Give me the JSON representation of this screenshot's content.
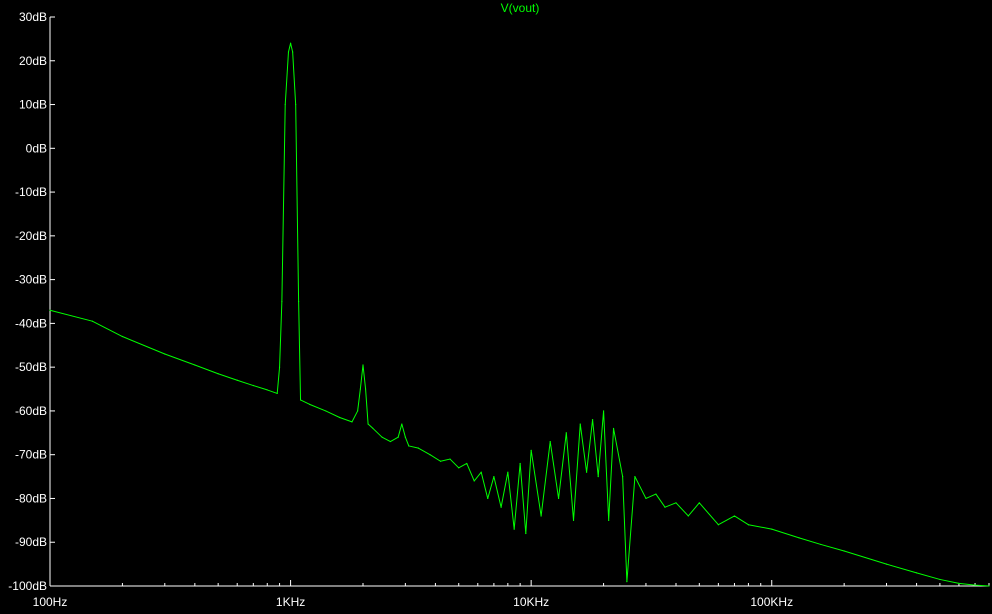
{
  "colors": {
    "background": "#000000",
    "axis": "#ffffff",
    "trace": "#00ff00",
    "title": "#00ff00",
    "tick_text": "#ffffff"
  },
  "chart_data": {
    "type": "line",
    "title": "V(vout)",
    "xlabel": "",
    "ylabel": "",
    "x_scale": "log",
    "xlim": [
      100,
      800000
    ],
    "ylim": [
      -100,
      30
    ],
    "y_ticks": [
      30,
      20,
      10,
      0,
      -10,
      -20,
      -30,
      -40,
      -50,
      -60,
      -70,
      -80,
      -90,
      -100
    ],
    "y_tick_labels": [
      "30dB",
      "20dB",
      "10dB",
      "0dB",
      "-10dB",
      "-20dB",
      "-30dB",
      "-40dB",
      "-50dB",
      "-60dB",
      "-70dB",
      "-80dB",
      "-90dB",
      "-100dB"
    ],
    "x_ticks": [
      100,
      1000,
      10000,
      100000
    ],
    "x_tick_labels": [
      "100Hz",
      "1KHz",
      "10KHz",
      "100KHz"
    ],
    "grid": false,
    "series": [
      {
        "name": "V(vout)",
        "x": [
          100,
          150,
          200,
          300,
          400,
          500,
          600,
          700,
          800,
          880,
          900,
          920,
          950,
          980,
          1000,
          1020,
          1050,
          1080,
          1100,
          1200,
          1400,
          1600,
          1800,
          1900,
          1950,
          2000,
          2050,
          2100,
          2200,
          2400,
          2600,
          2800,
          2900,
          3000,
          3100,
          3400,
          3800,
          4200,
          4600,
          5000,
          5400,
          5800,
          6200,
          6600,
          7000,
          7500,
          8000,
          8500,
          9000,
          9500,
          10000,
          11000,
          12000,
          13000,
          14000,
          15000,
          16000,
          17000,
          18000,
          19000,
          20000,
          21000,
          22000,
          24000,
          25000,
          27000,
          30000,
          33000,
          36000,
          40000,
          45000,
          50000,
          60000,
          70000,
          80000,
          100000,
          130000,
          160000,
          200000,
          300000,
          400000,
          500000,
          600000,
          700000,
          800000
        ],
        "y": [
          -37,
          -39.5,
          -43,
          -47,
          -49.5,
          -51.5,
          -53,
          -54.2,
          -55.2,
          -56,
          -50,
          -35,
          10,
          22,
          24,
          22,
          10,
          -35,
          -57.5,
          -58.5,
          -60,
          -61.5,
          -62.5,
          -60,
          -55,
          -49.5,
          -55,
          -63,
          -64,
          -66,
          -67,
          -66,
          -63,
          -66,
          -68,
          -68.5,
          -70,
          -71.5,
          -71,
          -73,
          -72,
          -76,
          -74,
          -80,
          -75,
          -82,
          -74,
          -87,
          -72,
          -88,
          -69,
          -84,
          -67,
          -80,
          -65,
          -85,
          -63,
          -74,
          -62,
          -75,
          -60,
          -85,
          -64,
          -75,
          -99,
          -75,
          -80,
          -79,
          -82,
          -81,
          -84,
          -81,
          -86,
          -84,
          -86,
          -87,
          -89,
          -90.5,
          -92,
          -95,
          -97,
          -98.5,
          -99.4,
          -99.8,
          -100
        ]
      }
    ]
  }
}
